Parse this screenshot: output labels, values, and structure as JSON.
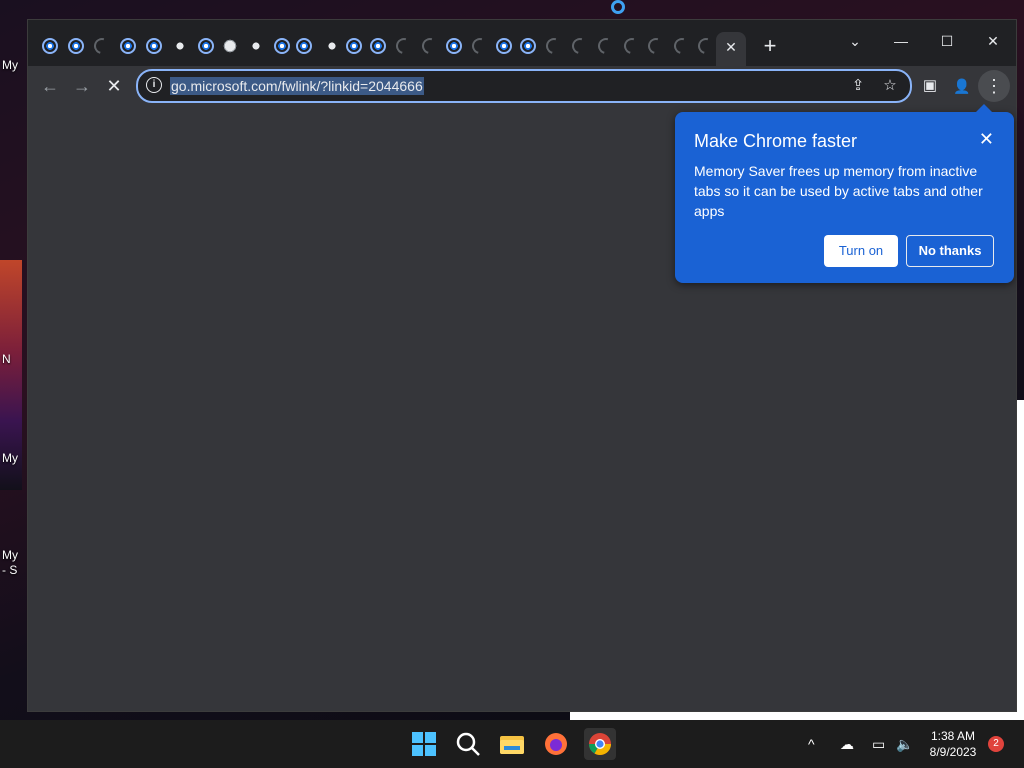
{
  "desktop": {
    "icon_labels": [
      "My",
      "N",
      "My",
      "My",
      "- S"
    ]
  },
  "chrome": {
    "active_tab_close": "✕",
    "new_tab": "+",
    "window_controls": {
      "dropdown": "⌄",
      "minimize": "—",
      "maximize": "☐",
      "close": "✕"
    },
    "toolbar": {
      "back": "←",
      "forward": "→",
      "stop": "✕",
      "url": "go.microsoft.com/fwlink/?linkid=2044666",
      "info": "i",
      "share": "⇪",
      "bookmark": "☆",
      "side_panel": "▣",
      "profile": "👤",
      "menu": "⋮"
    }
  },
  "promo": {
    "title": "Make Chrome faster",
    "body": "Memory Saver frees up memory from inactive tabs so it can be used by active tabs and other apps",
    "close": "✕",
    "turn_on": "Turn on",
    "no_thanks": "No thanks"
  },
  "taskbar": {
    "time": "1:38 AM",
    "date": "8/9/2023",
    "notifications": "2",
    "chevron": "^"
  }
}
